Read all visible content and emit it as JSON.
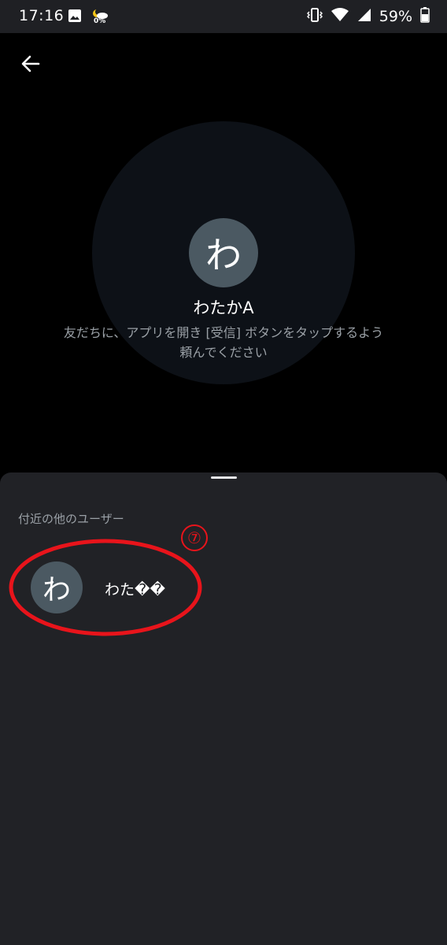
{
  "status_bar": {
    "time": "17:16",
    "weather_percent": "0%",
    "battery_percent": "59%",
    "icons": [
      "image-icon",
      "weather-icon",
      "vibrate-icon",
      "wifi-icon",
      "signal-icon",
      "battery-icon"
    ]
  },
  "header": {
    "back_icon": "arrow-left-icon"
  },
  "self": {
    "avatar_initial": "わ",
    "name": "わたかA",
    "hint": "友だちに、アプリを開き [受信] ボタンをタップするよう頼んでください"
  },
  "sheet": {
    "section_title": "付近の他のユーザー",
    "users": [
      {
        "avatar_initial": "わ",
        "name": "わた��"
      }
    ]
  },
  "annotation": {
    "number": "⑦",
    "color": "#e8141b"
  },
  "colors": {
    "background": "#000000",
    "status_bar": "#1f2024",
    "circle": "#0d1117",
    "avatar": "#4b5962",
    "sheet": "#212226",
    "secondary_text": "#9aa0a6"
  }
}
